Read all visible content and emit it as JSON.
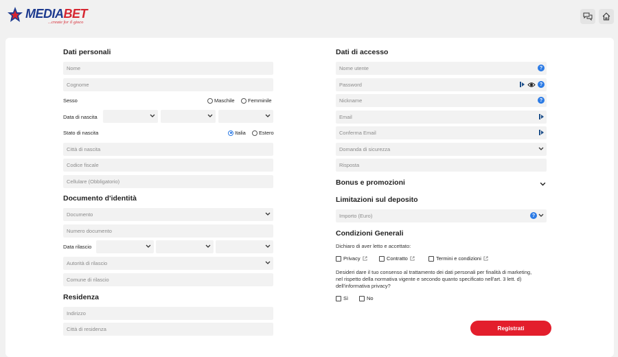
{
  "brand": {
    "name_blue": "MEDIA",
    "name_red": "BET",
    "tagline": "...create for il gioco"
  },
  "header": {
    "chat_icon": "chat-icon",
    "home_icon": "home-icon"
  },
  "personal": {
    "title": "Dati personali",
    "nome": "Nome",
    "cognome": "Cognome",
    "sesso_label": "Sesso",
    "maschile": "Maschile",
    "femminile": "Femminile",
    "data_nascita_label": "Data di nascita",
    "stato_nascita_label": "Stato di nascita",
    "italia": "Italia",
    "estero": "Estero",
    "citta_nascita": "Città di nascita",
    "codice_fiscale": "Codice fiscale",
    "cellulare": "Cellulare (Obbligatorio)"
  },
  "document": {
    "title": "Documento d'identità",
    "documento": "Documento",
    "numero": "Numero documento",
    "data_rilascio_label": "Data rilascio",
    "autorita": "Autorità di rilascio",
    "comune": "Comune di rilascio"
  },
  "residence": {
    "title": "Residenza",
    "indirizzo": "Indirizzo",
    "citta": "Città di residenza"
  },
  "access": {
    "title": "Dati di accesso",
    "nome_utente": "Nome utente",
    "password": "Password",
    "nickname": "Nickname",
    "email": "Email",
    "conferma_email": "Conferma Email",
    "domanda": "Domanda di sicurezza",
    "risposta": "Risposta"
  },
  "bonus": {
    "title": "Bonus e promozioni"
  },
  "deposit": {
    "title": "Limitazioni sul deposito",
    "importo": "Importo (Euro)"
  },
  "terms": {
    "title": "Condizioni Generali",
    "intro": "Dichiaro di aver letto e accettato:",
    "privacy": "Privacy",
    "contratto": "Contratto",
    "termini": "Termini e condizioni",
    "consent_line1": "Desideri dare il tuo consenso al trattamento dei dati personali per finalità di marketing,",
    "consent_line2": "nel rispetto della normativa vigente e secondo quanto specificato nell'art. 3 lett. d)",
    "consent_line3": "dell'informativa privacy?",
    "si": "Sì",
    "no": "No"
  },
  "submit": {
    "label": "Registrati"
  },
  "colors": {
    "accent_red": "#e31e2c",
    "brand_blue": "#1d3a8f",
    "help_blue": "#2c7be5"
  }
}
